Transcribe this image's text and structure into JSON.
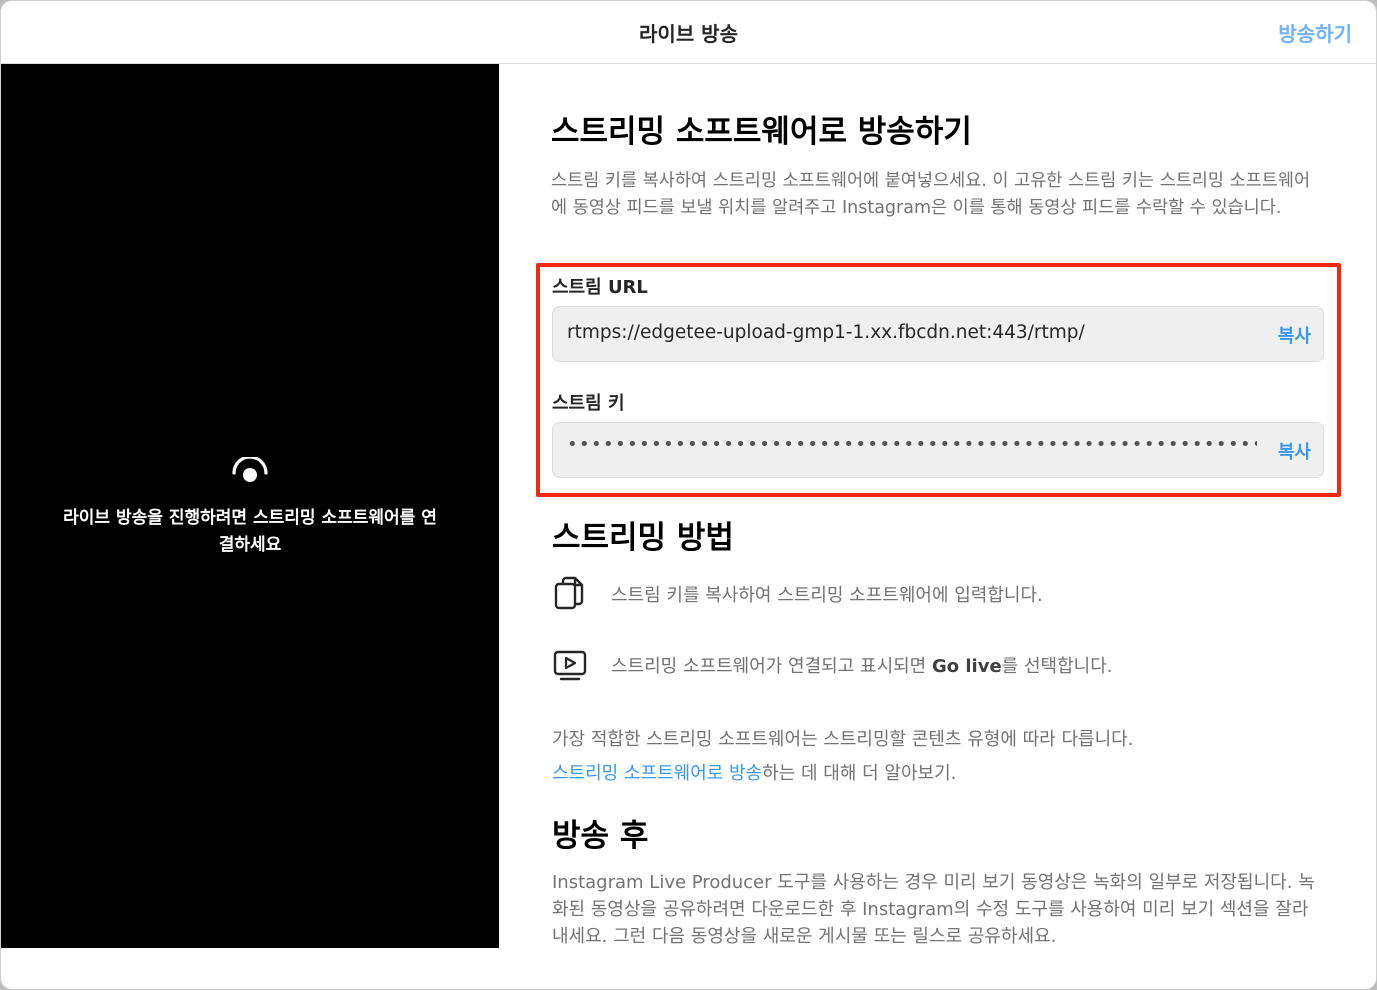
{
  "header": {
    "title": "라이브 방송",
    "action_label": "방송하기"
  },
  "preview": {
    "icon": "live-broadcast-icon",
    "message": "라이브 방송을 진행하려면 스트리밍 소프트웨어를 연결하세요"
  },
  "main": {
    "heading": "스트리밍 소프트웨어로 방송하기",
    "description": "스트림 키를 복사하여 스트리밍 소프트웨어에 붙여넣으세요. 이 고유한 스트림 키는 스트리밍 소프트웨어에 동영상 피드를 보낼 위치를 알려주고 Instagram은 이를 통해 동영상 피드를 수락할 수 있습니다.",
    "stream_url": {
      "label": "스트림 URL",
      "value": "rtmps://edgetee-upload-gmp1-1.xx.fbcdn.net:443/rtmp/",
      "copy_label": "복사"
    },
    "stream_key": {
      "label": "스트림 키",
      "value": "••••••••••••••••••••••••••••••••••••••••••••••••••••••••••••••••••••••••••••••••",
      "copy_label": "복사"
    },
    "highlight_color": "#ef2a10"
  },
  "how_to": {
    "heading": "스트리밍 방법",
    "steps": [
      {
        "icon": "copy-icon",
        "text": "스트림 키를 복사하여 스트리밍 소프트웨어에 입력합니다."
      },
      {
        "icon": "play-screen-icon",
        "text_before": "스트리밍 소프트웨어가 연결되고 표시되면 ",
        "text_bold": "Go live",
        "text_after": "를 선택합니다."
      }
    ],
    "note": "가장 적합한 스트리밍 소프트웨어는 스트리밍할 콘텐츠 유형에 따라 다릅니다.",
    "learn_link": "스트리밍 소프트웨어로 방송",
    "learn_suffix": "하는 데 대해 더 알아보기."
  },
  "after": {
    "heading": "방송 후",
    "text": "Instagram Live Producer 도구를 사용하는 경우 미리 보기 동영상은 녹화의 일부로 저장됩니다. 녹화된 동영상을 공유하려면 다운로드한 후 Instagram의 수정 도구를 사용하여 미리 보기 섹션을 잘라내세요. 그런 다음 동영상을 새로운 게시물 또는 릴스로 공유하세요."
  },
  "colors": {
    "accent": "#3897f0",
    "header_action": "#6fb3f5",
    "preview_bg": "#000000"
  }
}
